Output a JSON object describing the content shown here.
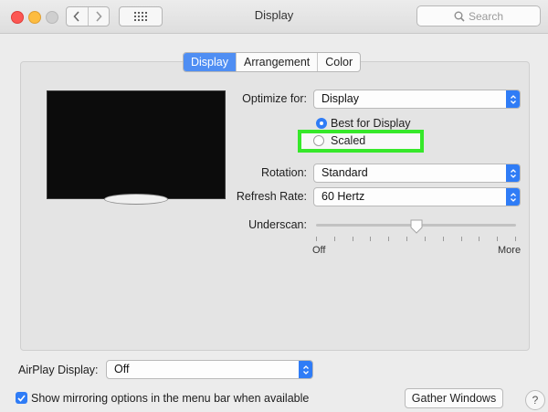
{
  "window": {
    "title": "Display"
  },
  "search": {
    "placeholder": "Search"
  },
  "tabs": [
    {
      "label": "Display",
      "active": true
    },
    {
      "label": "Arrangement",
      "active": false
    },
    {
      "label": "Color",
      "active": false
    }
  ],
  "optimize": {
    "label": "Optimize for:",
    "value": "Display",
    "options": [
      {
        "label": "Best for Display",
        "selected": true
      },
      {
        "label": "Scaled",
        "selected": false
      }
    ]
  },
  "rotation": {
    "label": "Rotation:",
    "value": "Standard"
  },
  "refresh": {
    "label": "Refresh Rate:",
    "value": "60 Hertz"
  },
  "underscan": {
    "label": "Underscan:",
    "min_label": "Off",
    "max_label": "More",
    "level": 0.5
  },
  "airplay": {
    "label": "AirPlay Display:",
    "value": "Off"
  },
  "mirroring": {
    "label": "Show mirroring options in the menu bar when available",
    "checked": true
  },
  "gather_button": "Gather Windows",
  "help_button": "?",
  "colors": {
    "accent": "#2f7cf6",
    "highlight": "#36e82a",
    "tab_active": "#4f8ef3"
  }
}
